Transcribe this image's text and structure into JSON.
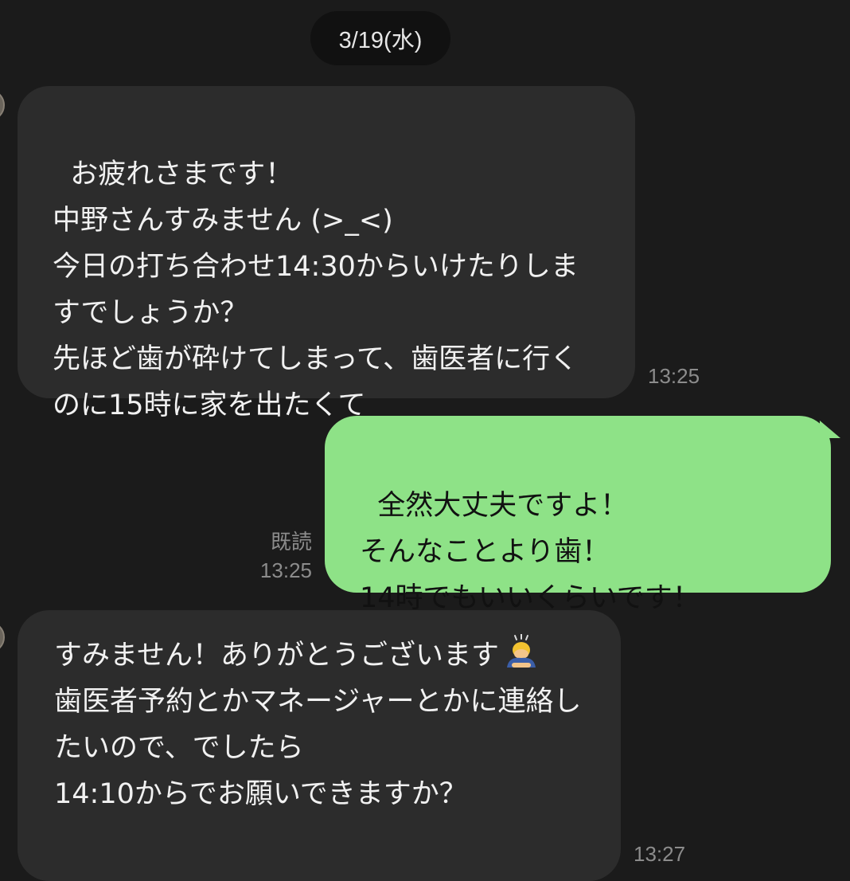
{
  "chat": {
    "date": "3/19(水)",
    "messages": [
      {
        "side": "received",
        "text": "お疲れさまです！\n中野さんすみません (>_<)\n今日の打ち合わせ14:30からいけたりしますでしょうか？\n先ほど歯が砕けてしまって、歯医者に行くのに15時に家を出たくて",
        "time": "13:25"
      },
      {
        "side": "sent",
        "text": "全然大丈夫ですよ！\nそんなことより歯！\n14時でもいいくらいです！",
        "read_label": "既読",
        "time": "13:25"
      },
      {
        "side": "received",
        "text_before_emoji": "すみません！ありがとうございます",
        "emoji": "bowing-person-emoji",
        "text_after_emoji": "\n歯医者予約とかマネージャーとかに連絡したいので、でしたら\n14:10からでお願いできますか？",
        "time": "13:27"
      }
    ]
  },
  "colors": {
    "background": "#1b1b1b",
    "incoming_bubble": "#2c2c2c",
    "outgoing_bubble": "#8ee287",
    "meta_text": "#8c8c8c"
  }
}
